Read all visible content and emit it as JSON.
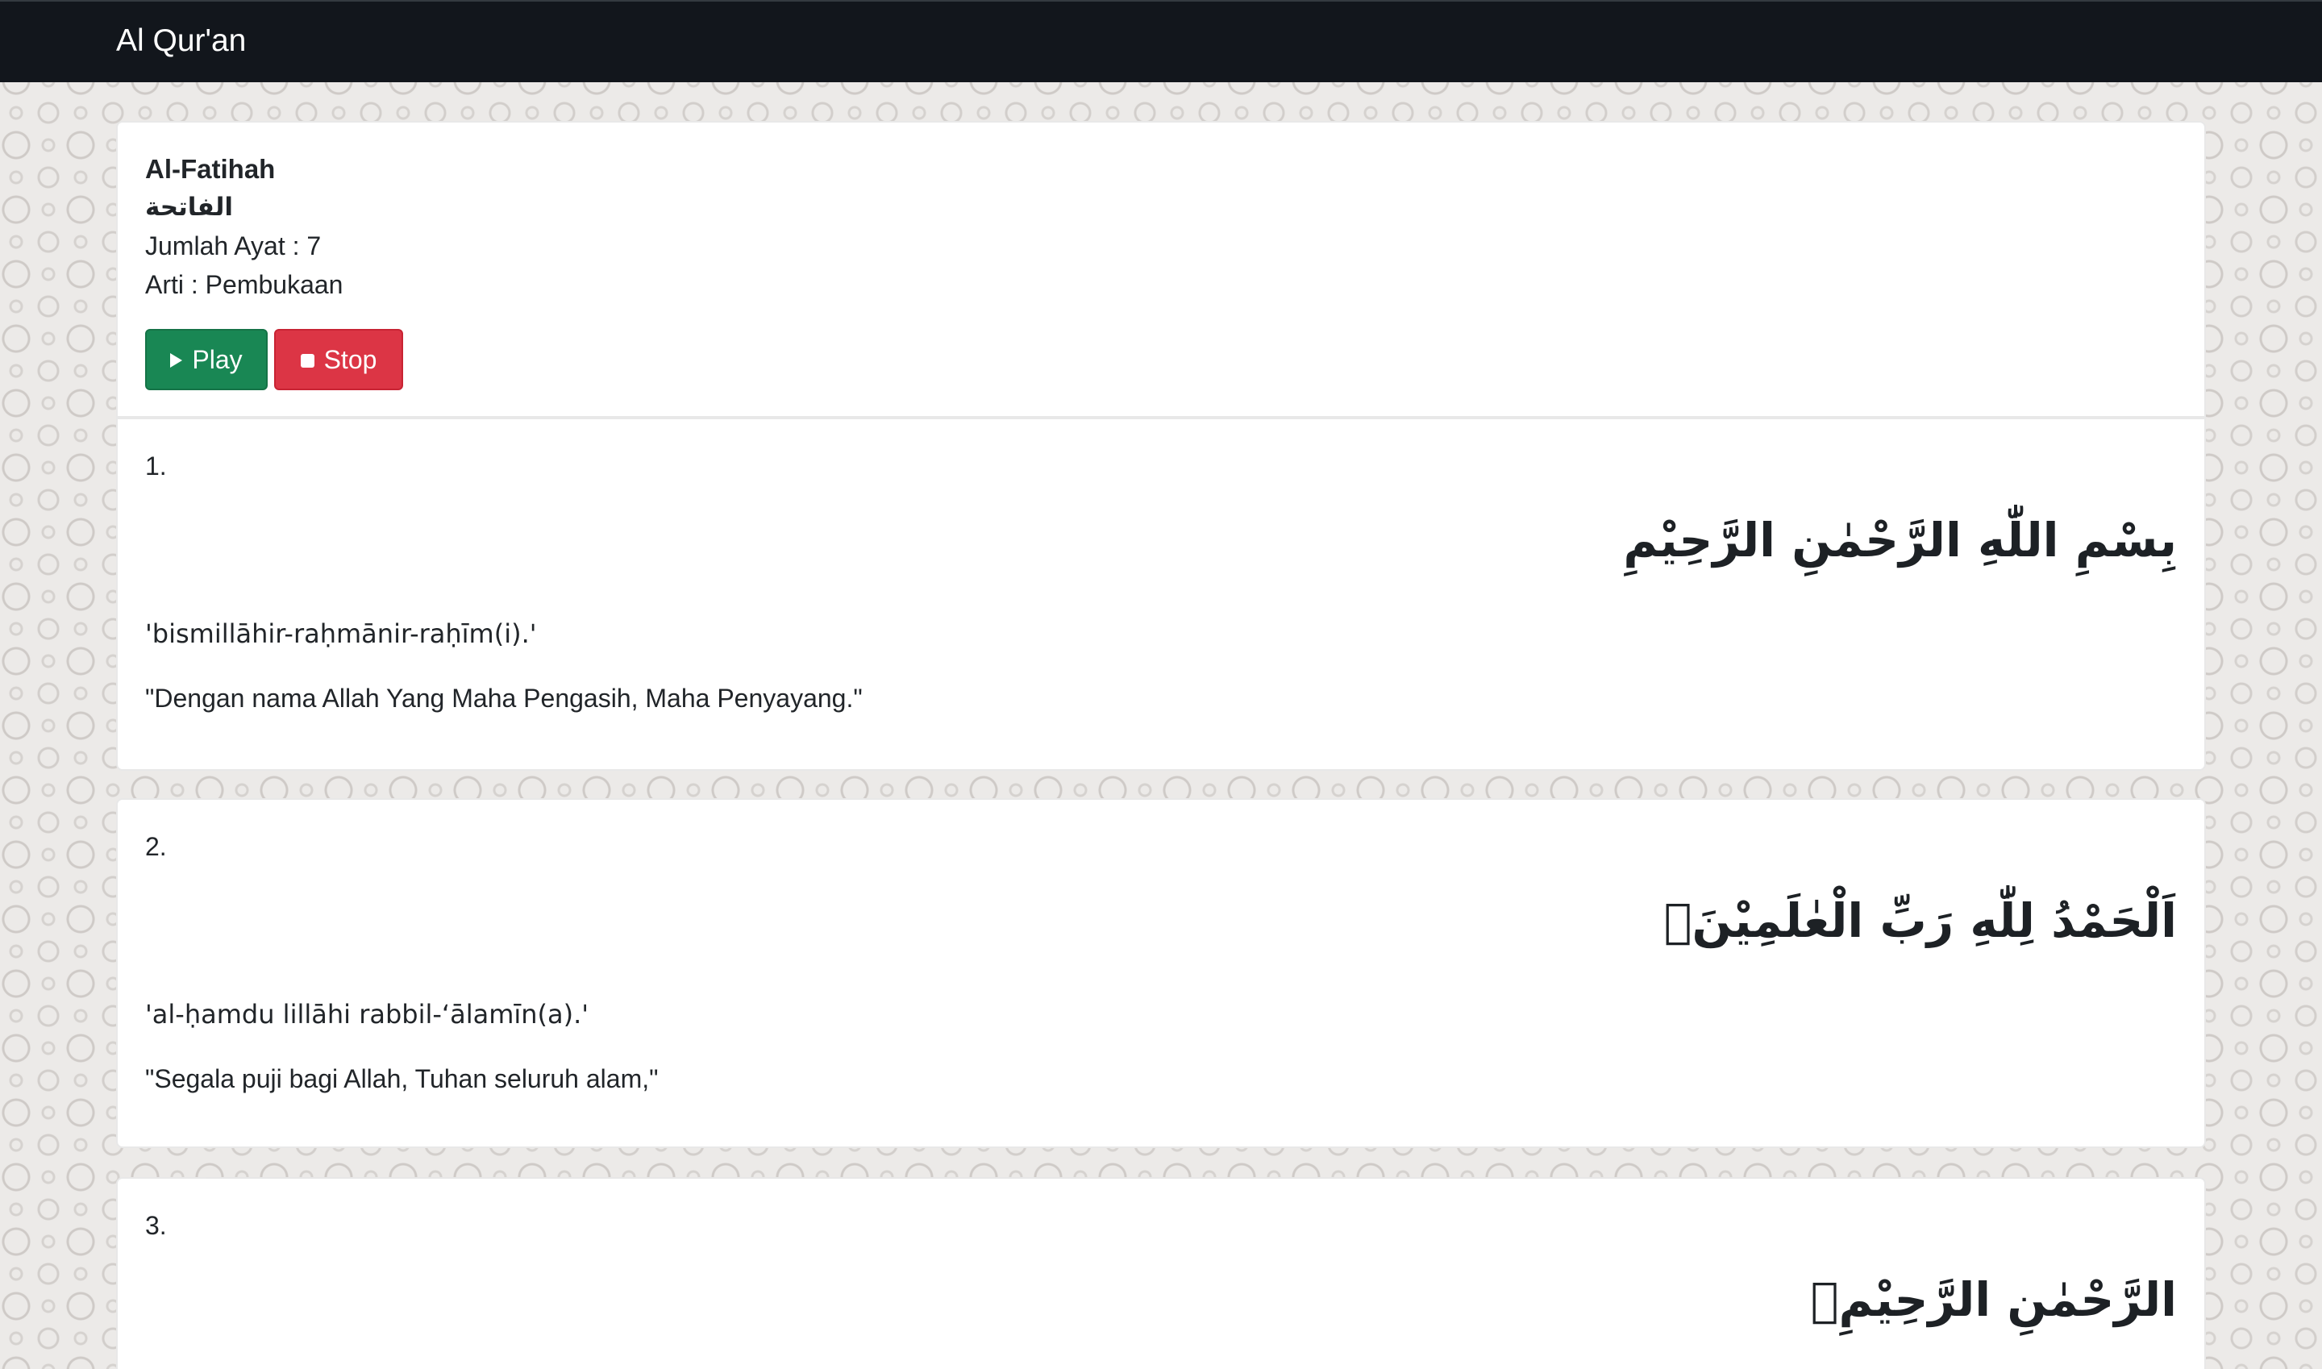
{
  "navbar": {
    "brand": "Al Qur'an"
  },
  "surah": {
    "name_latin": "Al-Fatihah",
    "name_arabic": "الفاتحة",
    "ayat_count_text": "Jumlah Ayat : 7",
    "meaning_text": "Arti : Pembukaan",
    "play_label": "Play",
    "stop_label": "Stop",
    "play_icon": "play-icon",
    "stop_icon": "stop-icon"
  },
  "colors": {
    "navbar_bg": "#12161c",
    "play_button": "#198754",
    "stop_button": "#dc3545"
  },
  "ayahs": [
    {
      "number": "1.",
      "arabic": "بِسْمِ اللّٰهِ الرَّحْمٰنِ الرَّحِيْمِ",
      "latin": "'bismillāhir-raḥmānir-raḥīm(i).'",
      "translation": "\"Dengan nama Allah Yang Maha Pengasih, Maha Penyayang.\""
    },
    {
      "number": "2.",
      "arabic": "اَلْحَمْدُ لِلّٰهِ رَبِّ الْعٰلَمِيْنَۙ",
      "latin": "'al-ḥamdu lillāhi rabbil-‘ālamīn(a).'",
      "translation": "\"Segala puji bagi Allah, Tuhan seluruh alam,\""
    },
    {
      "number": "3.",
      "arabic": "الرَّحْمٰنِ الرَّحِيْمِۙ"
    }
  ]
}
